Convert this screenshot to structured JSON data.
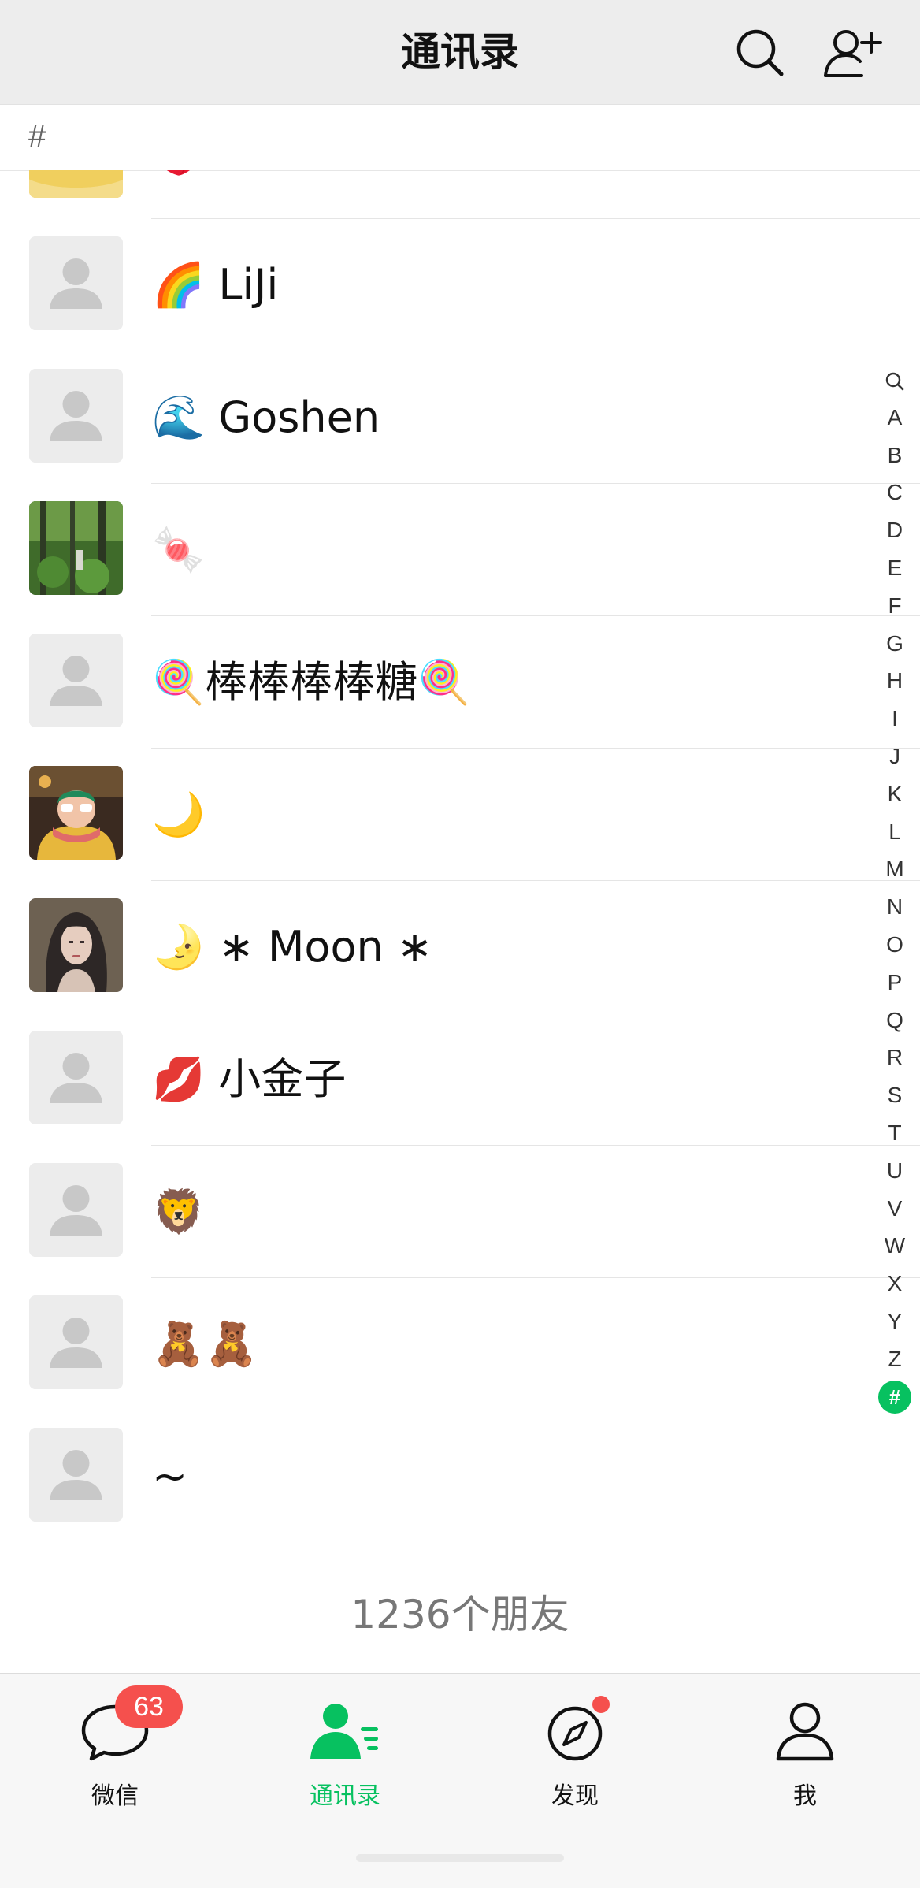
{
  "nav": {
    "title": "通讯录",
    "search_icon": "search-icon",
    "add_contact_icon": "add-contact-icon",
    "background": "#ededed"
  },
  "section": {
    "label": "#"
  },
  "contacts": [
    {
      "name": "🍑",
      "avatar": "photo-yellow"
    },
    {
      "name": "🌈 LiJi",
      "avatar": "default"
    },
    {
      "name": "🌊 Goshen",
      "avatar": "default"
    },
    {
      "name": "🍬",
      "avatar": "photo-forest"
    },
    {
      "name": "🍭棒棒棒棒糖🍭",
      "avatar": "default"
    },
    {
      "name": "🌙",
      "avatar": "photo-person"
    },
    {
      "name": "🌛 ∗ Moon ∗",
      "avatar": "photo-portrait"
    },
    {
      "name": "💋 小金子",
      "avatar": "default"
    },
    {
      "name": "🦁",
      "avatar": "default"
    },
    {
      "name": "🧸🧸",
      "avatar": "default"
    },
    {
      "name": "~",
      "avatar": "default"
    }
  ],
  "index_bar": {
    "letters": [
      "🔍",
      "A",
      "B",
      "C",
      "D",
      "E",
      "F",
      "G",
      "H",
      "I",
      "J",
      "K",
      "L",
      "M",
      "N",
      "O",
      "P",
      "Q",
      "R",
      "S",
      "T",
      "U",
      "V",
      "W",
      "X",
      "Y",
      "Z",
      "#"
    ],
    "active": "#"
  },
  "footer": {
    "count_text": "1236个朋友"
  },
  "tabs": [
    {
      "label": "微信",
      "icon": "chat-bubble-icon",
      "badge": "63"
    },
    {
      "label": "通讯录",
      "icon": "contacts-icon",
      "active": true
    },
    {
      "label": "发现",
      "icon": "compass-icon",
      "dot": true
    },
    {
      "label": "我",
      "icon": "person-icon"
    }
  ],
  "colors": {
    "accent": "#07c160",
    "badge": "#f5504d"
  }
}
